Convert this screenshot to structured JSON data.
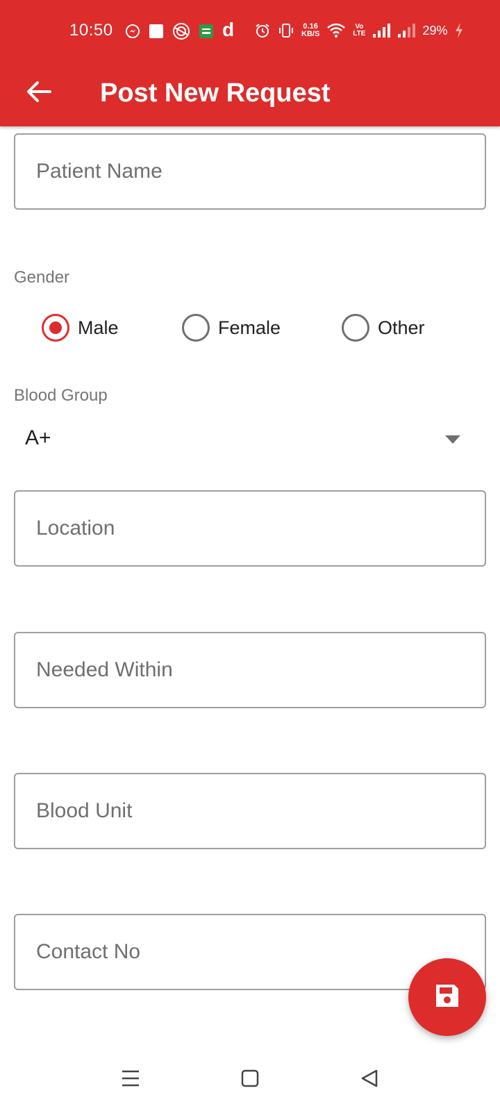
{
  "status_bar": {
    "time": "10:50",
    "network_speed_value": "0.16",
    "network_speed_unit": "KB/S",
    "volte_top": "Vo",
    "volte_bottom": "LTE",
    "battery_percent": "29%",
    "app_letter": "d",
    "left_icons": [
      "messenger-icon",
      "square-app-icon",
      "shell-app-icon",
      "green-app-icon",
      "d-app-icon"
    ],
    "right_icons": [
      "alarm-icon",
      "vibrate-icon",
      "wifi-icon",
      "signal-icon",
      "signal-weak-icon",
      "charging-icon"
    ]
  },
  "toolbar": {
    "title": "Post New Request",
    "back_icon": "arrow-left-icon"
  },
  "form": {
    "patient_name_placeholder": "Patient Name",
    "gender_label": "Gender",
    "gender_options": [
      "Male",
      "Female",
      "Other"
    ],
    "gender_selected": "Male",
    "blood_group_label": "Blood Group",
    "blood_group_value": "A+",
    "location_placeholder": "Location",
    "needed_within_placeholder": "Needed Within",
    "blood_unit_placeholder": "Blood Unit",
    "contact_no_placeholder": "Contact No"
  },
  "fab": {
    "icon": "save-icon"
  },
  "nav": {
    "icons": [
      "menu-icon",
      "home-square-icon",
      "back-triangle-icon"
    ]
  },
  "colors": {
    "primary": "#dd2c2c",
    "border": "#9e9e9e",
    "hint": "#6f6f6f",
    "label": "#757575"
  }
}
